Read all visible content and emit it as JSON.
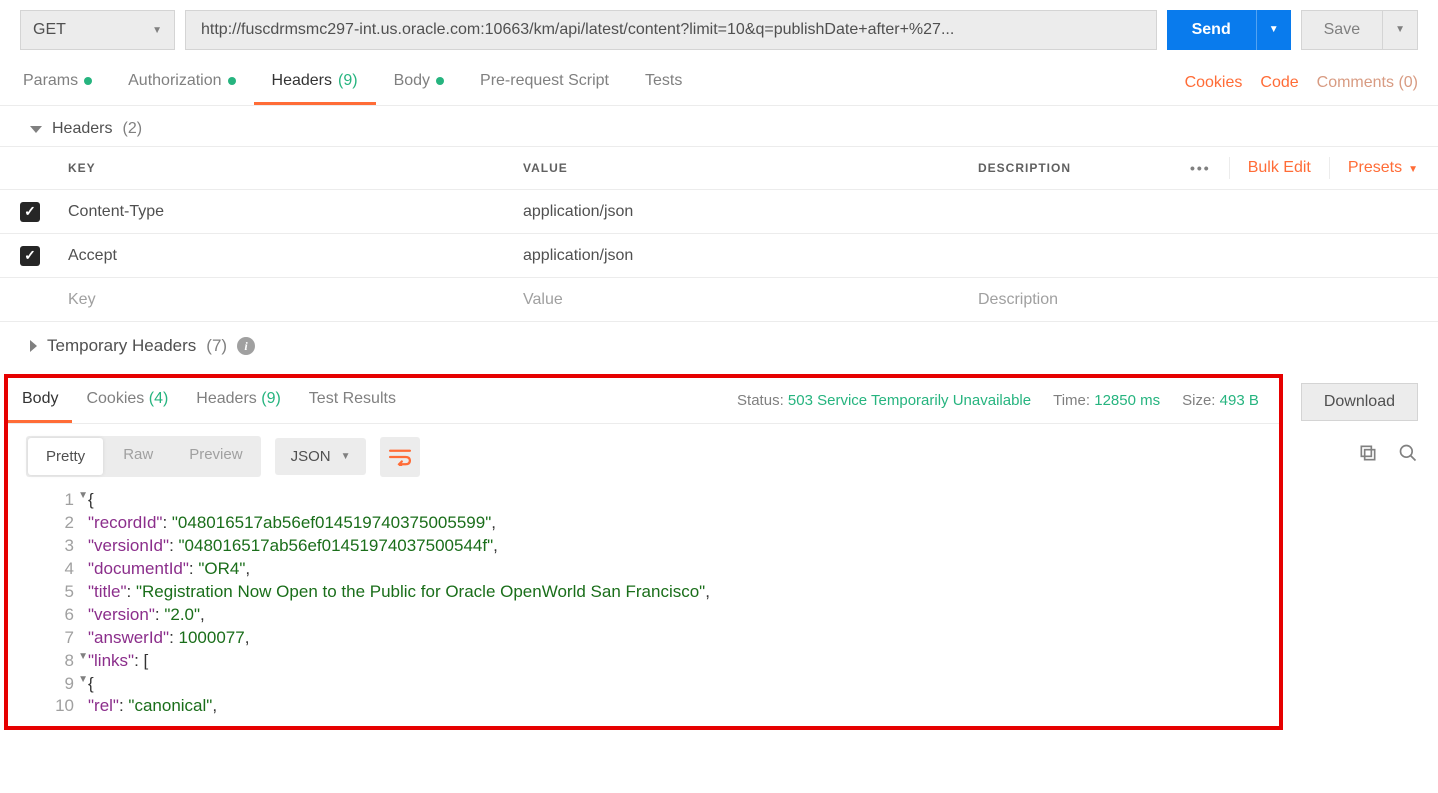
{
  "request": {
    "method": "GET",
    "url": "http://fuscdrmsmc297-int.us.oracle.com:10663/km/api/latest/content?limit=10&q=publishDate+after+%27...",
    "send_label": "Send",
    "save_label": "Save"
  },
  "req_tabs": {
    "params": "Params",
    "authorization": "Authorization",
    "headers": "Headers",
    "headers_count": "(9)",
    "body": "Body",
    "pre": "Pre-request Script",
    "tests": "Tests"
  },
  "req_links": {
    "cookies": "Cookies",
    "code": "Code",
    "comments": "Comments (0)"
  },
  "headers_section": {
    "title": "Headers",
    "count": "(2)",
    "cols": {
      "key": "KEY",
      "value": "VALUE",
      "desc": "DESCRIPTION"
    },
    "bulk": "Bulk Edit",
    "presets": "Presets",
    "rows": [
      {
        "key": "Content-Type",
        "value": "application/json"
      },
      {
        "key": "Accept",
        "value": "application/json"
      }
    ],
    "placeholders": {
      "key": "Key",
      "value": "Value",
      "desc": "Description"
    },
    "temp_title": "Temporary Headers",
    "temp_count": "(7)"
  },
  "response": {
    "tabs": {
      "body": "Body",
      "cookies": "Cookies",
      "cookies_count": "(4)",
      "headers": "Headers",
      "headers_count": "(9)",
      "tests": "Test Results"
    },
    "status_label": "Status:",
    "status_value": "503 Service Temporarily Unavailable",
    "time_label": "Time:",
    "time_value": "12850 ms",
    "size_label": "Size:",
    "size_value": "493 B",
    "download": "Download",
    "view": {
      "pretty": "Pretty",
      "raw": "Raw",
      "preview": "Preview",
      "format": "JSON"
    },
    "body_lines": [
      {
        "n": "1",
        "fold": true,
        "tokens": [
          {
            "t": "p",
            "v": "{"
          }
        ]
      },
      {
        "n": "2",
        "tokens": [
          {
            "t": "k",
            "v": "\"recordId\""
          },
          {
            "t": "p",
            "v": ": "
          },
          {
            "t": "s",
            "v": "\"048016517ab56ef014519740375005599\""
          },
          {
            "t": "p",
            "v": ","
          }
        ]
      },
      {
        "n": "3",
        "tokens": [
          {
            "t": "k",
            "v": "\"versionId\""
          },
          {
            "t": "p",
            "v": ": "
          },
          {
            "t": "s",
            "v": "\"048016517ab56ef01451974037500544f\""
          },
          {
            "t": "p",
            "v": ","
          }
        ]
      },
      {
        "n": "4",
        "tokens": [
          {
            "t": "k",
            "v": "\"documentId\""
          },
          {
            "t": "p",
            "v": ": "
          },
          {
            "t": "s",
            "v": "\"OR4\""
          },
          {
            "t": "p",
            "v": ","
          }
        ]
      },
      {
        "n": "5",
        "tokens": [
          {
            "t": "k",
            "v": "\"title\""
          },
          {
            "t": "p",
            "v": ": "
          },
          {
            "t": "s",
            "v": "\"Registration Now Open to the Public for Oracle OpenWorld San Francisco\""
          },
          {
            "t": "p",
            "v": ","
          }
        ]
      },
      {
        "n": "6",
        "tokens": [
          {
            "t": "k",
            "v": "\"version\""
          },
          {
            "t": "p",
            "v": ": "
          },
          {
            "t": "s",
            "v": "\"2.0\""
          },
          {
            "t": "p",
            "v": ","
          }
        ]
      },
      {
        "n": "7",
        "tokens": [
          {
            "t": "k",
            "v": "\"answerId\""
          },
          {
            "t": "p",
            "v": ": "
          },
          {
            "t": "n",
            "v": "1000077"
          },
          {
            "t": "p",
            "v": ","
          }
        ]
      },
      {
        "n": "8",
        "fold": true,
        "tokens": [
          {
            "t": "k",
            "v": "\"links\""
          },
          {
            "t": "p",
            "v": ": ["
          }
        ]
      },
      {
        "n": "9",
        "fold": true,
        "tokens": [
          {
            "t": "p",
            "v": "{"
          }
        ]
      },
      {
        "n": "10",
        "tokens": [
          {
            "t": "k",
            "v": "\"rel\""
          },
          {
            "t": "p",
            "v": ": "
          },
          {
            "t": "s",
            "v": "\"canonical\""
          },
          {
            "t": "p",
            "v": ","
          }
        ]
      }
    ]
  }
}
